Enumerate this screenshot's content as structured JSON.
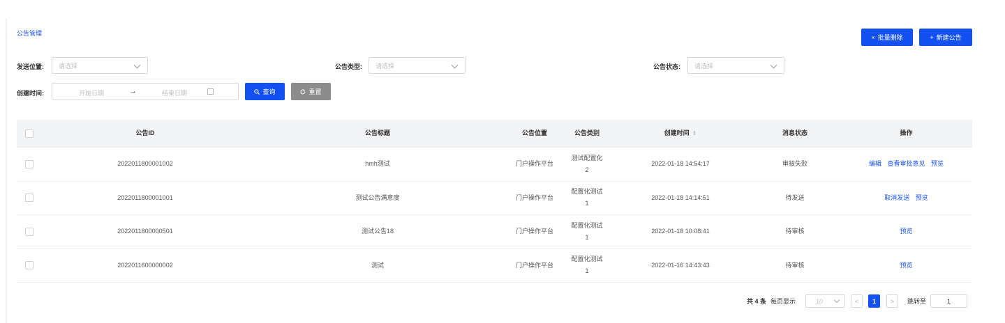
{
  "breadcrumb": "公告管理",
  "toolbar": {
    "batch_delete": "批量删除",
    "batch_delete_icon": "×",
    "new_notice": "新建公告",
    "new_notice_icon": "+"
  },
  "filters": {
    "send_position": {
      "label": "发送位置:",
      "placeholder": "请选择"
    },
    "notice_type": {
      "label": "公告类型:",
      "placeholder": "请选择"
    },
    "notice_status": {
      "label": "公告状态:",
      "placeholder": "请选择"
    },
    "created_time": {
      "label": "创建时间:",
      "start_placeholder": "开始日期",
      "end_placeholder": "结束日期",
      "arrow": "→"
    },
    "query_button": "查询",
    "reset_button": "重置"
  },
  "table": {
    "headers": {
      "id": "公告ID",
      "title": "公告标题",
      "position": "公告位置",
      "type": "公告类别",
      "created": "创建时间",
      "status": "消息状态",
      "ops": "操作"
    },
    "rows": [
      {
        "id": "2022011800001002",
        "title": "hmh测试",
        "position": "门户操作平台",
        "type": "测试配置化2",
        "created": "2022-01-18 14:54:17",
        "status": "审核失败",
        "ops": [
          "编辑",
          "查看审批意见",
          "预览"
        ]
      },
      {
        "id": "2022011800001001",
        "title": "测试公告满意度",
        "position": "门户操作平台",
        "type": "配置化测试1",
        "created": "2022-01-18 14:14:51",
        "status": "待发送",
        "ops": [
          "取消发送",
          "预览"
        ]
      },
      {
        "id": "2022011800000501",
        "title": "测试公告18",
        "position": "门户操作平台",
        "type": "配置化测试1",
        "created": "2022-01-18 10:08:41",
        "status": "待审核",
        "ops": [
          "预览"
        ]
      },
      {
        "id": "2022011600000002",
        "title": "测试",
        "position": "门户操作平台",
        "type": "配置化测试1",
        "created": "2022-01-16 14:43:43",
        "status": "待审核",
        "ops": [
          "预览"
        ]
      }
    ]
  },
  "pagination": {
    "total": "共 4 条",
    "per_page_label": "每页显示",
    "per_page_value": "10",
    "prev": "<",
    "current": "1",
    "next": ">",
    "jump_label": "跳转至",
    "jump_value": "1"
  },
  "colors": {
    "primary": "#1250f0",
    "link": "#1a56f0",
    "header_bg": "#f3f4f6"
  }
}
